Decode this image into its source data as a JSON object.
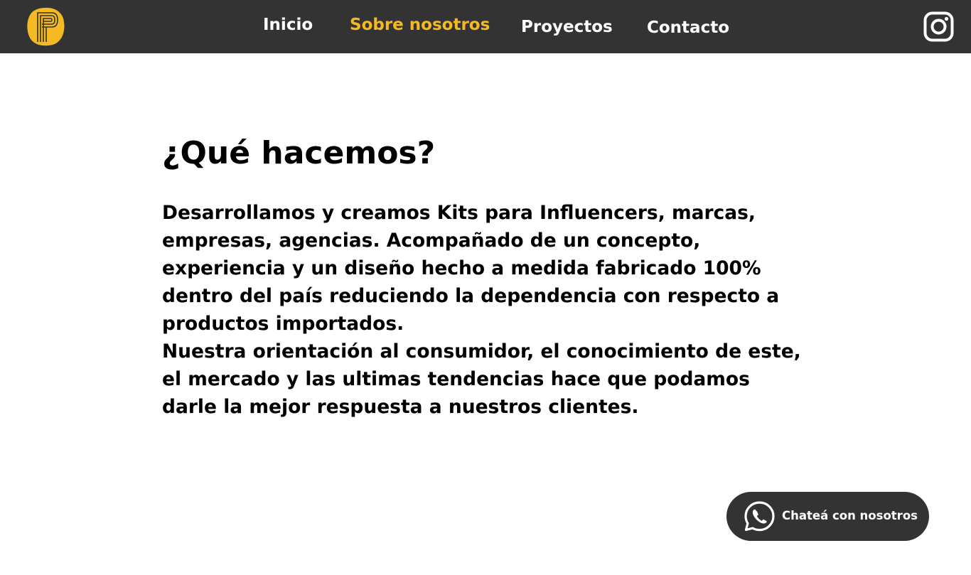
{
  "colors": {
    "nav_bg": "#333333",
    "accent": "#f5b923",
    "text": "#000000",
    "chat_bg": "#333333"
  },
  "header": {
    "logo_icon": "letter-p-logo-icon",
    "nav": [
      {
        "label": "Inicio",
        "active": false
      },
      {
        "label": "Sobre nosotros",
        "active": true
      },
      {
        "label": "Proyectos",
        "active": false
      },
      {
        "label": "Contacto",
        "active": false
      }
    ],
    "social_icon": "instagram-icon"
  },
  "main": {
    "title": "¿Qué hacemos?",
    "body": "Desarrollamos y creamos Kits para Influencers, marcas, empresas, agencias. Acompañado de un concepto, experiencia y un diseño hecho a medida fabricado 100% dentro del país reduciendo la dependencia con respecto a productos importados.\nNuestra orientación al consumidor, el conocimiento de este, el mercado y las ultimas tendencias hace que podamos darle la mejor respuesta a nuestros clientes."
  },
  "chat": {
    "icon": "whatsapp-icon",
    "label": "Chateá con nosotros"
  }
}
